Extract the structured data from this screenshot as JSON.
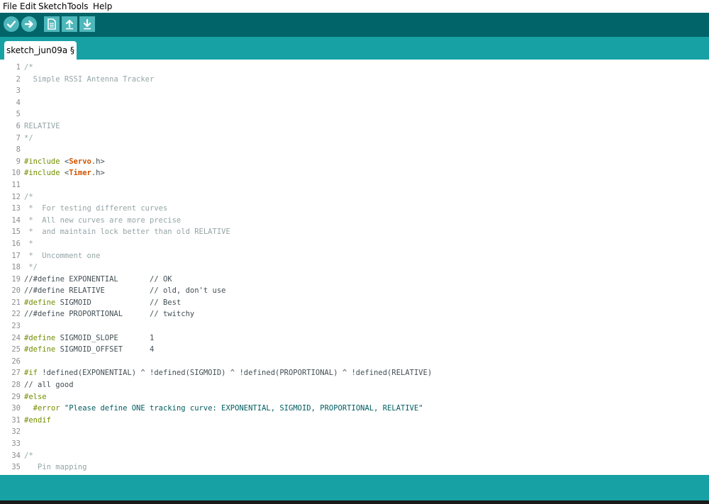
{
  "menu": {
    "items": [
      {
        "label": "File"
      },
      {
        "label": "Edit"
      },
      {
        "label": "Sketch"
      },
      {
        "label": "Tools"
      },
      {
        "label": "Help"
      }
    ]
  },
  "toolbar": {
    "buttons": [
      {
        "name": "verify",
        "icon": "checkmark-icon"
      },
      {
        "name": "upload",
        "icon": "arrow-right-icon"
      },
      {
        "name": "new",
        "icon": "new-file-icon"
      },
      {
        "name": "open",
        "icon": "open-arrow-up-icon"
      },
      {
        "name": "save",
        "icon": "save-arrow-down-icon"
      }
    ]
  },
  "tabs": [
    {
      "label": "sketch_jun09a §"
    }
  ],
  "editor": {
    "lines": [
      {
        "n": "1",
        "s": [
          {
            "t": "/*",
            "c": "comment"
          }
        ]
      },
      {
        "n": "2",
        "s": [
          {
            "t": "  Simple RSSI Antenna Tracker",
            "c": "comment"
          }
        ]
      },
      {
        "n": "3",
        "s": []
      },
      {
        "n": "4",
        "s": []
      },
      {
        "n": "5",
        "s": []
      },
      {
        "n": "6",
        "s": [
          {
            "t": "RELATIVE",
            "c": "comment"
          }
        ]
      },
      {
        "n": "7",
        "s": [
          {
            "t": "*/",
            "c": "comment"
          }
        ]
      },
      {
        "n": "8",
        "s": []
      },
      {
        "n": "9",
        "s": [
          {
            "t": "#include ",
            "c": "kw"
          },
          {
            "t": "<",
            "c": "plain"
          },
          {
            "t": "Servo",
            "c": "lib"
          },
          {
            "t": ".h>",
            "c": "plain"
          }
        ]
      },
      {
        "n": "10",
        "s": [
          {
            "t": "#include ",
            "c": "kw"
          },
          {
            "t": "<",
            "c": "plain"
          },
          {
            "t": "Timer",
            "c": "lib"
          },
          {
            "t": ".h>",
            "c": "plain"
          }
        ]
      },
      {
        "n": "11",
        "s": []
      },
      {
        "n": "12",
        "s": [
          {
            "t": "/*",
            "c": "comment"
          }
        ]
      },
      {
        "n": "13",
        "s": [
          {
            "t": " *  For testing different curves",
            "c": "comment"
          }
        ]
      },
      {
        "n": "14",
        "s": [
          {
            "t": " *  All new curves are more precise",
            "c": "comment"
          }
        ]
      },
      {
        "n": "15",
        "s": [
          {
            "t": " *  and maintain lock better than old RELATIVE",
            "c": "comment"
          }
        ]
      },
      {
        "n": "16",
        "s": [
          {
            "t": " *",
            "c": "comment"
          }
        ]
      },
      {
        "n": "17",
        "s": [
          {
            "t": " *  Uncomment one",
            "c": "comment"
          }
        ]
      },
      {
        "n": "18",
        "s": [
          {
            "t": " */",
            "c": "comment"
          }
        ]
      },
      {
        "n": "19",
        "s": [
          {
            "t": "//#define EXPONENTIAL       // OK",
            "c": "plain"
          }
        ]
      },
      {
        "n": "20",
        "s": [
          {
            "t": "//#define RELATIVE          // old, don't use",
            "c": "plain"
          }
        ]
      },
      {
        "n": "21",
        "s": [
          {
            "t": "#define",
            "c": "kw"
          },
          {
            "t": " SIGMOID             // Best",
            "c": "plain"
          }
        ]
      },
      {
        "n": "22",
        "s": [
          {
            "t": "//#define PROPORTIONAL      // twitchy",
            "c": "plain"
          }
        ]
      },
      {
        "n": "23",
        "s": []
      },
      {
        "n": "24",
        "s": [
          {
            "t": "#define",
            "c": "kw"
          },
          {
            "t": " SIGMOID_SLOPE       1",
            "c": "plain"
          }
        ]
      },
      {
        "n": "25",
        "s": [
          {
            "t": "#define",
            "c": "kw"
          },
          {
            "t": " SIGMOID_OFFSET      4",
            "c": "plain"
          }
        ]
      },
      {
        "n": "26",
        "s": []
      },
      {
        "n": "27",
        "s": [
          {
            "t": "#if",
            "c": "kw"
          },
          {
            "t": " !defined(EXPONENTIAL) ^ !defined(SIGMOID) ^ !defined(PROPORTIONAL) ^ !defined(RELATIVE)",
            "c": "plain"
          }
        ]
      },
      {
        "n": "28",
        "s": [
          {
            "t": "// all good",
            "c": "plain"
          }
        ]
      },
      {
        "n": "29",
        "s": [
          {
            "t": "#else",
            "c": "kw"
          }
        ]
      },
      {
        "n": "30",
        "s": [
          {
            "t": "  ",
            "c": "plain"
          },
          {
            "t": "#error",
            "c": "kw"
          },
          {
            "t": " \"Please define ONE tracking curve: EXPONENTIAL, SIGMOID, PROPORTIONAL, RELATIVE\"",
            "c": "str"
          }
        ]
      },
      {
        "n": "31",
        "s": [
          {
            "t": "#endif",
            "c": "kw"
          }
        ]
      },
      {
        "n": "32",
        "s": []
      },
      {
        "n": "33",
        "s": []
      },
      {
        "n": "34",
        "s": [
          {
            "t": "/*",
            "c": "comment"
          }
        ]
      },
      {
        "n": "35",
        "s": [
          {
            "t": "   Pin mapping",
            "c": "comment"
          }
        ]
      }
    ]
  },
  "colors": {
    "toolbar_bg": "#006468",
    "tabbar_bg": "#17a1a5",
    "button_bg": "#4db7bb",
    "comment": "#95a5a6",
    "keyword": "#728e00",
    "library": "#d35400"
  }
}
